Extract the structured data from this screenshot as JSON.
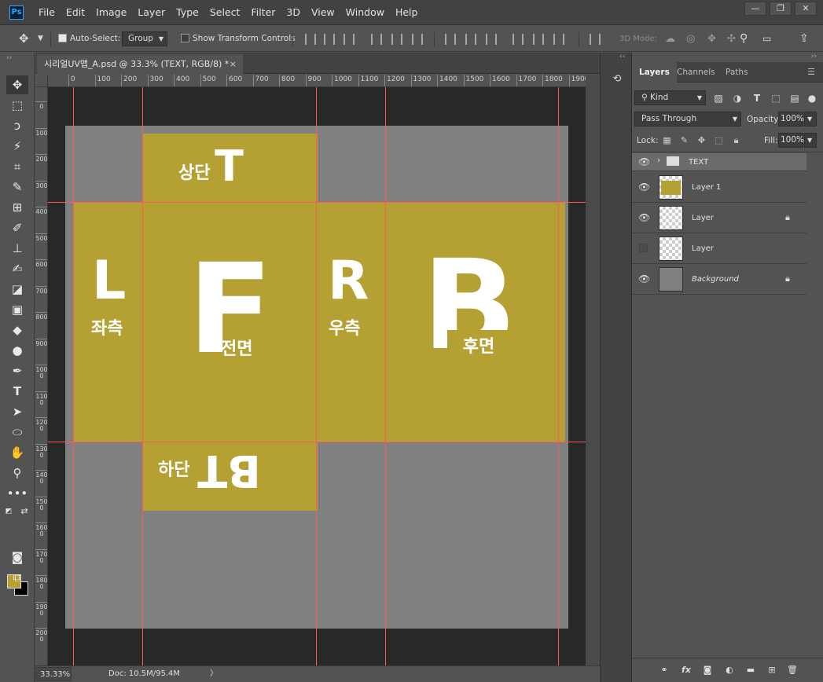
{
  "app": {
    "logo": "Ps"
  },
  "menu": [
    "File",
    "Edit",
    "Image",
    "Layer",
    "Type",
    "Select",
    "Filter",
    "3D",
    "View",
    "Window",
    "Help"
  ],
  "window_controls": {
    "minimize": "—",
    "restore": "❐",
    "close": "✕"
  },
  "options_bar": {
    "auto_select_label": "Auto-Select:",
    "auto_select_checked": true,
    "auto_select_value": "Group",
    "show_transform_label": "Show Transform Controls",
    "mode_3d_label": "3D Mode:"
  },
  "document": {
    "tab_title": "시리얼UV맵_A.psd @ 33.3% (TEXT, RGB/8) *",
    "close_glyph": "×",
    "zoom": "33.33%",
    "doc_size": "Doc: 10.5M/95.4M",
    "status_arrow": "〉",
    "ruler_h_labels": [
      "0",
      "100",
      "200",
      "300",
      "400",
      "500",
      "600",
      "700",
      "800",
      "900",
      "1000",
      "1100",
      "1200",
      "1300",
      "1400",
      "1500",
      "1600",
      "1700",
      "1800",
      "1900"
    ],
    "ruler_v_labels": [
      "0",
      "100",
      "200",
      "300",
      "400",
      "500",
      "600",
      "700",
      "800",
      "900",
      "1000",
      "1100",
      "1200",
      "1300",
      "1400",
      "1500",
      "1600",
      "1700",
      "1800",
      "1900",
      "2000"
    ],
    "artwork": {
      "top_label": "상단",
      "top_letter": "T",
      "left_letter": "L",
      "left_label": "좌측",
      "front_letter": "F",
      "front_label": "전면",
      "right_letter": "R",
      "right_label": "우측",
      "back_letter": "B",
      "back_label": "후면",
      "bottom_label": "하단",
      "bottom_letters": "BT"
    },
    "colors": {
      "uv_fill": "#b5a033",
      "doc_bg": "#808080",
      "guide": "#ff5a5a"
    }
  },
  "foreground_color": "#b5a033",
  "background_color": "#000000",
  "layers_panel": {
    "tabs": [
      "Layers",
      "Channels",
      "Paths"
    ],
    "active_tab": "Layers",
    "filter_value": "Kind",
    "blend_mode": "Pass Through",
    "opacity_label": "Opacity:",
    "opacity_value": "100%",
    "lock_label": "Lock:",
    "fill_label": "Fill:",
    "fill_value": "100%",
    "layers": [
      {
        "name": "TEXT",
        "type": "group",
        "visible": true,
        "locked": false
      },
      {
        "name": "Layer 1",
        "type": "pixel",
        "visible": true,
        "locked": false
      },
      {
        "name": "Layer",
        "type": "pixel",
        "visible": true,
        "locked": true
      },
      {
        "name": "Layer",
        "type": "pixel",
        "visible": false,
        "locked": false
      },
      {
        "name": "Background",
        "type": "background",
        "visible": true,
        "locked": true
      }
    ],
    "footer_icons": [
      "link-icon",
      "fx-icon",
      "mask-icon",
      "adjustment-icon",
      "folder-icon",
      "new-layer-icon",
      "trash-icon"
    ]
  }
}
